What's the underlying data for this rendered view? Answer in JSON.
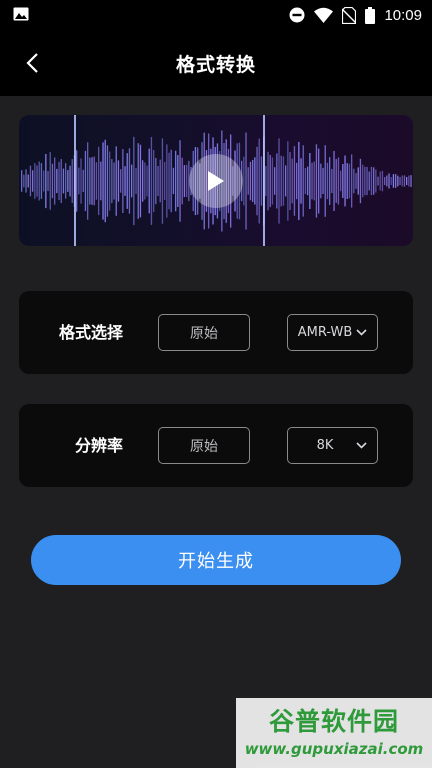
{
  "status_bar": {
    "time": "10:09",
    "left_icon": "image-icon",
    "right_icons": [
      "do-not-disturb-icon",
      "wifi-icon",
      "no-sim-icon",
      "battery-icon"
    ]
  },
  "header": {
    "title": "格式转换",
    "back_icon": "chevron-left-icon"
  },
  "player": {
    "play_icon": "play-icon",
    "wave_colors": [
      "#41b6f5",
      "#7a6cf0",
      "#b55cf2",
      "#c66af0"
    ]
  },
  "format_row": {
    "label": "格式选择",
    "original": "原始",
    "selected": "AMR-WB"
  },
  "resolution_row": {
    "label": "分辨率",
    "original": "原始",
    "selected": "8K"
  },
  "start_button": {
    "label": "开始生成",
    "color": "#3b8ff0"
  },
  "watermark": {
    "title": "谷普软件园",
    "url": "www.gupuxiazai.com"
  }
}
